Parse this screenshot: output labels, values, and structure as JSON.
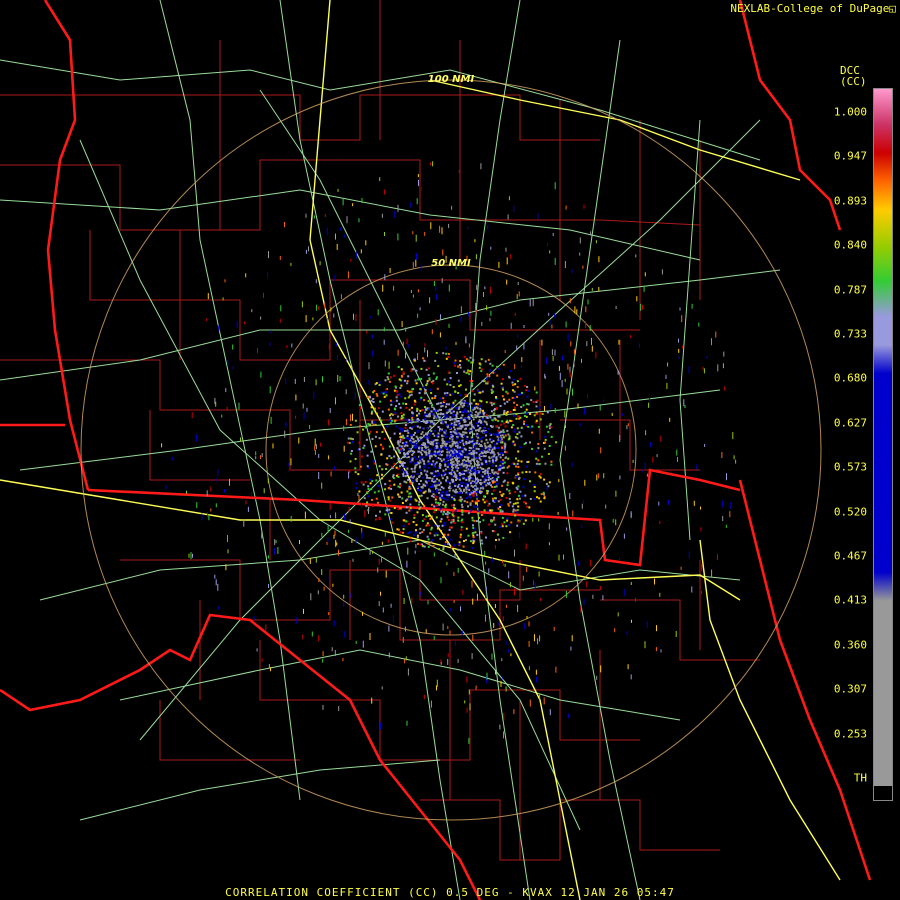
{
  "credit": "NEXLAB-College of DuPage",
  "credit_icon": "nexlab-logo-icon",
  "product_code": {
    "line1": "DCC",
    "line2": "(CC)"
  },
  "footer": "CORRELATION COEFFICIENT (CC) 0.5 DEG - KVAX 12 JAN 26 05:47",
  "range_rings": [
    {
      "label": "100 NMI",
      "range_nmi": 100
    },
    {
      "label": "50 NMI",
      "range_nmi": 50
    }
  ],
  "colorbar": {
    "ticks": [
      "1.000",
      "0.947",
      "0.893",
      "0.840",
      "0.787",
      "0.733",
      "0.680",
      "0.627",
      "0.573",
      "0.520",
      "0.467",
      "0.413",
      "0.360",
      "0.307",
      "0.253",
      "TH"
    ],
    "colors": {
      "pink_top": "#ff99cc",
      "magenta": "#cc3366",
      "red": "#cc0000",
      "orange": "#ff6600",
      "yellow": "#ffcc00",
      "yellow_green": "#99cc00",
      "green": "#33cc33",
      "lavender": "#9999dd",
      "blue": "#0000cc",
      "gray": "#999999",
      "th": "#000000"
    }
  },
  "map_colors": {
    "state_border": "#ff1a1a",
    "county_border": "#aa1a1a",
    "highway": "#99dd99",
    "interstate": "#ffff55",
    "range_ring": "#ddaa66"
  }
}
